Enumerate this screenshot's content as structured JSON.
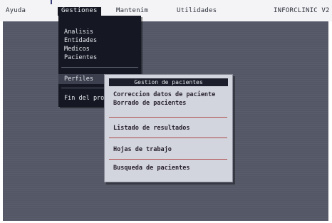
{
  "menubar": {
    "items": [
      {
        "label": "Ayuda"
      },
      {
        "label": "Gestiones"
      },
      {
        "label": "Mantenim"
      },
      {
        "label": "Utilidades"
      }
    ],
    "app_title": "INFORCLINIC V2"
  },
  "gestiones_menu": {
    "items": [
      {
        "label": "Analisis"
      },
      {
        "label": "Entidades"
      },
      {
        "label": "Medicos"
      },
      {
        "label": "Pacientes"
      },
      {
        "label": "Perfiles"
      },
      {
        "label": "Fin del proceso"
      }
    ]
  },
  "submenu": {
    "title": "Gestion de pacientes",
    "items": [
      {
        "label": "Correccion datos de paciente"
      },
      {
        "label": "Borrado de pacientes"
      },
      {
        "label": "Listado de resultados"
      },
      {
        "label": "Hojas de trabajo"
      },
      {
        "label": "Busqueda de pacientes"
      }
    ]
  },
  "colors": {
    "desktop": "#535766",
    "menu_bg": "#151822",
    "submenu_bg": "#d2d5dd",
    "separator_accent": "#b04a4a"
  }
}
